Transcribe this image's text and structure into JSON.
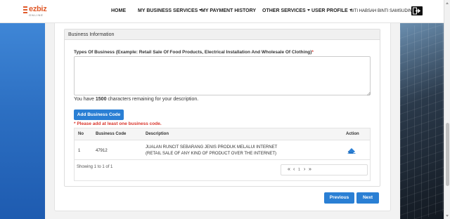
{
  "navbar": {
    "logo_text": "ezbiz",
    "logo_sub": "ONLINE",
    "items": [
      {
        "label": "HOME",
        "has_caret": false
      },
      {
        "label": "MY BUSINESS SERVICES",
        "has_caret": true
      },
      {
        "label": "MY PAYMENT HISTORY",
        "has_caret": false
      },
      {
        "label": "OTHER SERVICES",
        "has_caret": true
      },
      {
        "label": "USER PROFILE",
        "has_caret": true
      }
    ],
    "user_name": "SITI HABSAH BINTI SAMSUDIN",
    "logout_icon": "logout-icon"
  },
  "panel": {
    "heading": "Business Information",
    "types_label": "Types Of Business (Example: Retail Sale Of Food Products, Electrical Installation And Wholesale Of Clothing)",
    "required_mark": "*",
    "textarea_value": "",
    "chars_prefix": "You have ",
    "chars_count": "1500",
    "chars_suffix": " characters remaining for your description.",
    "add_button": "Add Business Code",
    "warning": "* Please add at least one business code."
  },
  "table": {
    "headers": [
      "No",
      "Business Code",
      "Description",
      "Action"
    ],
    "rows": [
      {
        "no": "1",
        "code": "47912",
        "desc_line1": "JUALAN RUNCIT SEBARANG JENIS PRODUK MELALUI INTERNET",
        "desc_line2": "(RETAIL SALE OF ANY KIND OF PRODUCT OVER THE INTERNET)",
        "action_icon": "eraser-icon"
      }
    ],
    "showing": "Showing 1 to 1 of 1",
    "pager": {
      "first": "«",
      "prev": "‹",
      "page": "1",
      "next": "›",
      "last": "»"
    }
  },
  "footer": {
    "previous": "Previous",
    "next": "Next"
  },
  "colors": {
    "accent": "#2a7fd4",
    "danger": "#d9342b",
    "brand": "#e05a2a"
  }
}
